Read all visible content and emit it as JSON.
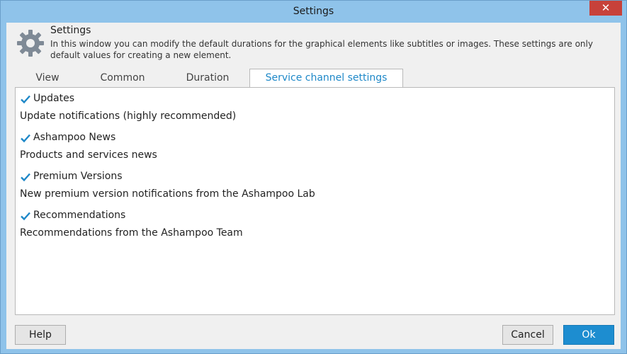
{
  "window": {
    "title": "Settings",
    "close_glyph": "✕"
  },
  "header": {
    "icon": "gear-icon",
    "title": "Settings",
    "description": "In this window you can modify the default durations for the graphical elements like subtitles or images. These settings are only default values for creating a new element."
  },
  "tabs": [
    {
      "label": "View",
      "active": false
    },
    {
      "label": "Common",
      "active": false
    },
    {
      "label": "Duration",
      "active": false
    },
    {
      "label": "Service channel settings",
      "active": true
    }
  ],
  "options": [
    {
      "label": "Updates",
      "checked": true,
      "description": "Update notifications (highly recommended)"
    },
    {
      "label": "Ashampoo News",
      "checked": true,
      "description": "Products and services news"
    },
    {
      "label": "Premium Versions",
      "checked": true,
      "description": "New premium version notifications from the Ashampoo Lab"
    },
    {
      "label": "Recommendations",
      "checked": true,
      "description": "Recommendations from the Ashampoo Team"
    }
  ],
  "buttons": {
    "help": "Help",
    "cancel": "Cancel",
    "ok": "Ok"
  },
  "colors": {
    "accent": "#1d8dd0",
    "title_bar": "#8fc3ea",
    "close": "#c7413a",
    "checkmark": "#1e88c8"
  }
}
